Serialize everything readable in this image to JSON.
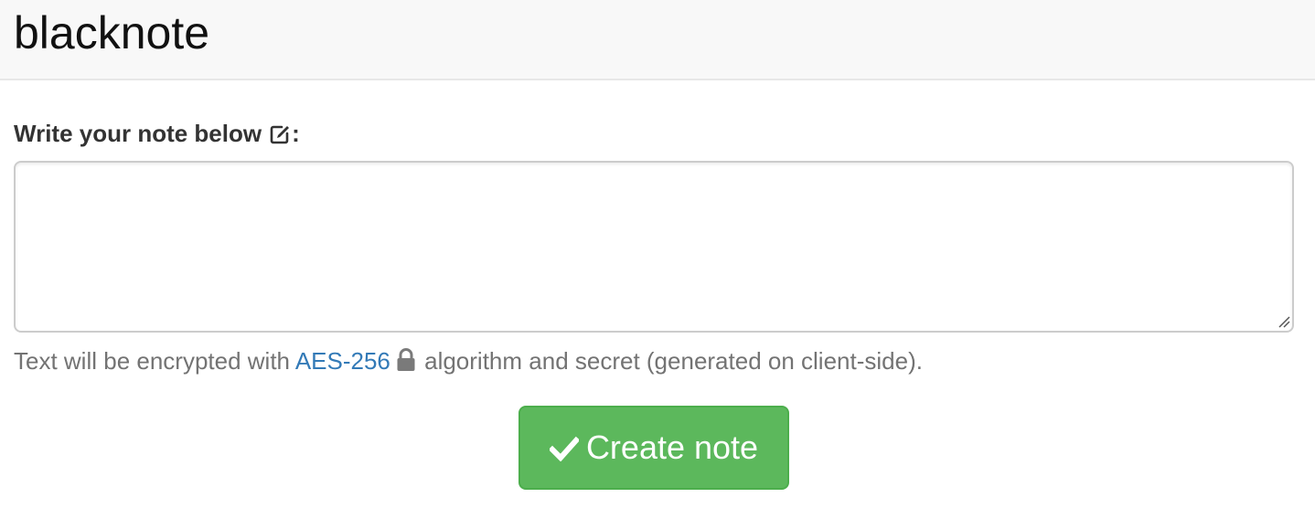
{
  "navbar": {
    "brand": "blacknote"
  },
  "form": {
    "label": "Write your note below",
    "label_suffix": ":",
    "label_icon": "edit-icon",
    "textarea_value": "",
    "help_prefix": "Text will be encrypted with ",
    "help_link": "AES-256",
    "help_icon": "lock-icon",
    "help_suffix": " algorithm and secret (generated on client-side).",
    "submit_label": "Create note",
    "submit_icon": "check-icon"
  },
  "colors": {
    "navbar_bg": "#f8f8f8",
    "link": "#337ab7",
    "button_bg": "#5cb85c",
    "button_border": "#4cae4c",
    "help_text": "#737373"
  }
}
